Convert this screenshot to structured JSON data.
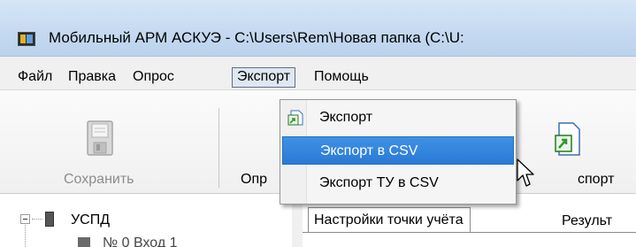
{
  "window": {
    "title": "Мобильный АРМ АСКУЭ - C:\\Users\\Rem\\Новая папка (C:\\U:"
  },
  "menubar": {
    "items": [
      "Файл",
      "Правка",
      "Опрос",
      "Экспорт",
      "Помощь"
    ],
    "open_item": "Экспорт"
  },
  "toolbar": {
    "save_label": "Сохранить",
    "poll_label": "Опр",
    "export_label": "спорт"
  },
  "dropdown": {
    "items": [
      {
        "label": "Экспорт",
        "icon": "export-icon"
      },
      {
        "label": "Экспорт в CSV",
        "highlighted": true
      },
      {
        "label": "Экспорт ТУ в CSV"
      }
    ]
  },
  "tree": {
    "root_label": "УСПД",
    "child_label": "№ 0 Вход 1"
  },
  "tabs": {
    "active": "Настройки точки учёта",
    "next": "Результ"
  },
  "colors": {
    "highlight": "#2a7ad6",
    "titlebar": "#c4d9f1",
    "export_icon_green": "#2e9a2e"
  }
}
